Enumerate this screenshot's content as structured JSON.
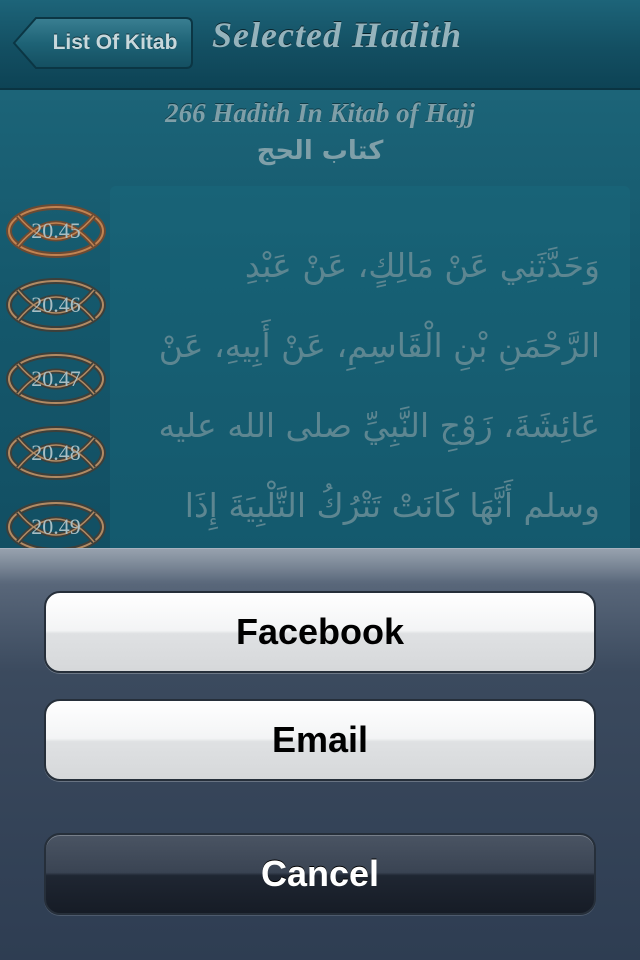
{
  "navbar": {
    "back_label": "List Of Kitab",
    "title": "Selected Hadith"
  },
  "content": {
    "subtitle": "266 Hadith In Kitab of Hajj",
    "arabic_title": "كتاب الحج",
    "hadith_numbers": [
      "20.45",
      "20.46",
      "20.47",
      "20.48",
      "20.49"
    ],
    "arabic_lines": [
      "وَحَدَّثَنِي عَنْ مَالِكٍ، عَنْ عَبْدِ",
      "الرَّحْمَنِ بْنِ الْقَاسِمِ، عَنْ أَبِيهِ، عَنْ",
      "عَائِشَةَ، زَوْجِ النَّبِيِّ صلى الله عليه",
      "وسلم أَنَّهَا كَانَتْ تَتْرُكُ التَّلْبِيَةَ إِذَا"
    ]
  },
  "action_sheet": {
    "facebook_label": "Facebook",
    "email_label": "Email",
    "cancel_label": "Cancel"
  },
  "colors": {
    "navbar": "#134f62",
    "content_bg": "#15596d",
    "badge_ring": "#b07a4a"
  }
}
